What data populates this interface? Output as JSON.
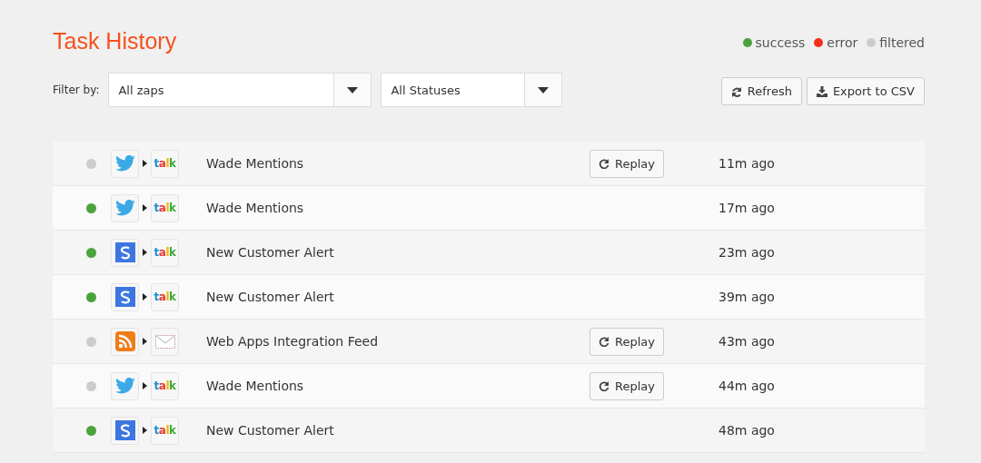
{
  "title": "Task History",
  "legend": [
    {
      "label": "success",
      "color": "#4ca23c"
    },
    {
      "label": "error",
      "color": "#f2311d"
    },
    {
      "label": "filtered",
      "color": "#cccccc"
    }
  ],
  "filter": {
    "label": "Filter by:",
    "selects": [
      {
        "value": "All zaps"
      },
      {
        "value": "All Statuses"
      }
    ]
  },
  "buttons": [
    {
      "kind": "refresh",
      "label": "Refresh"
    },
    {
      "kind": "export",
      "label": "Export to CSV"
    }
  ],
  "rows": [
    {
      "color": "#cccccc",
      "trigger": {
        "kind": "twitter"
      },
      "action": {
        "kind": "talk",
        "text": "talk"
      },
      "name": "Wade Mentions",
      "replay": "Replay",
      "time": "11m ago"
    },
    {
      "color": "#4ca23c",
      "trigger": {
        "kind": "twitter"
      },
      "action": {
        "kind": "talk",
        "text": "talk"
      },
      "name": "Wade Mentions",
      "time": "17m ago"
    },
    {
      "color": "#4ca23c",
      "trigger": {
        "kind": "s"
      },
      "action": {
        "kind": "talk",
        "text": "talk"
      },
      "name": "New Customer Alert",
      "time": "23m ago"
    },
    {
      "color": "#4ca23c",
      "trigger": {
        "kind": "s"
      },
      "action": {
        "kind": "talk",
        "text": "talk"
      },
      "name": "New Customer Alert",
      "time": "39m ago"
    },
    {
      "color": "#cccccc",
      "trigger": {
        "kind": "rss"
      },
      "action": {
        "kind": "mail"
      },
      "name": "Web Apps Integration Feed",
      "replay": "Replay",
      "time": "43m ago"
    },
    {
      "color": "#cccccc",
      "trigger": {
        "kind": "twitter"
      },
      "action": {
        "kind": "talk",
        "text": "talk"
      },
      "name": "Wade Mentions",
      "replay": "Replay",
      "time": "44m ago"
    },
    {
      "color": "#4ca23c",
      "trigger": {
        "kind": "s"
      },
      "action": {
        "kind": "talk",
        "text": "talk"
      },
      "name": "New Customer Alert",
      "time": "48m ago"
    }
  ]
}
